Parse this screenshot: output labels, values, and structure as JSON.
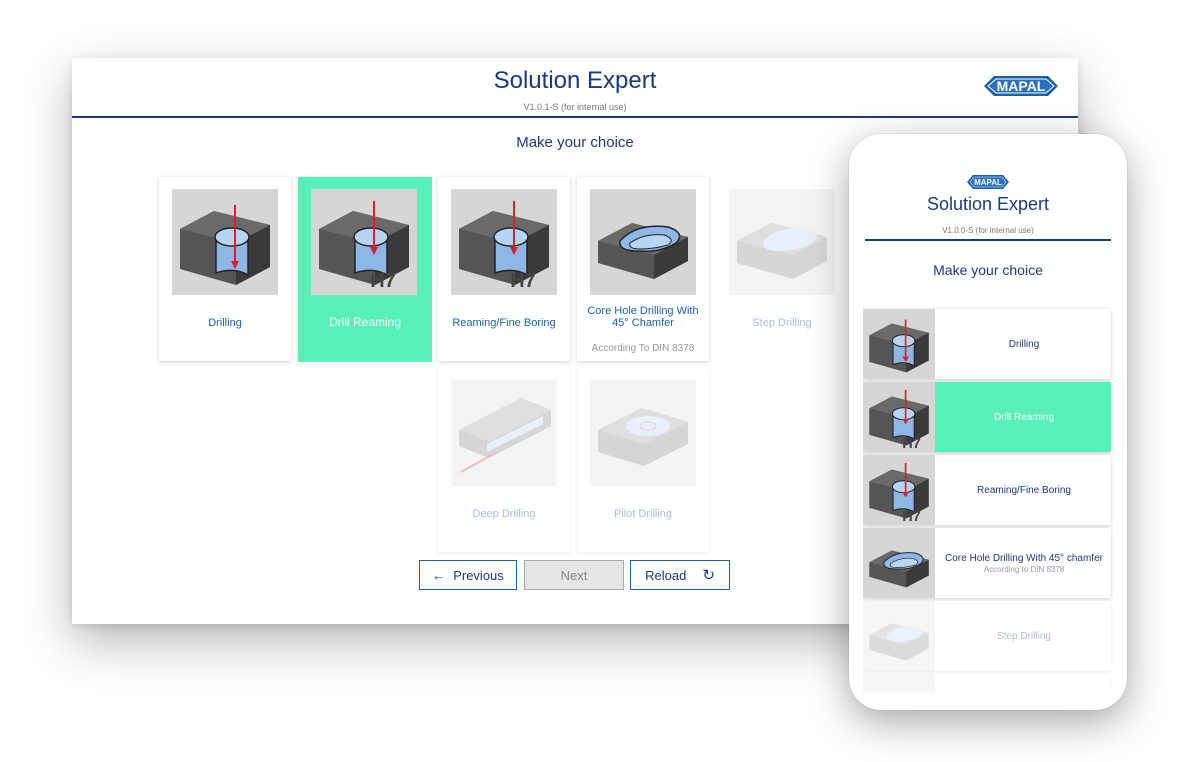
{
  "desktop": {
    "title": "Solution Expert",
    "version": "V1.0.1-S (for internal use)",
    "brand": "MAPAL",
    "choice_heading": "Make your choice",
    "cards": [
      {
        "label": "Drilling",
        "sub": "",
        "state": "normal",
        "icon": "drilling-icon"
      },
      {
        "label": "Drill Reaming",
        "sub": "",
        "state": "selected",
        "icon": "drill-reaming-icon",
        "badge": "H7"
      },
      {
        "label": "Reaming/Fine Boring",
        "sub": "",
        "state": "normal",
        "icon": "reaming-icon",
        "badge": "H7"
      },
      {
        "label": "Core Hole Drilling With 45° Chamfer",
        "sub": "According To DIN 8378",
        "state": "normal",
        "icon": "core-hole-icon"
      },
      {
        "label": "Step Drilling",
        "sub": "",
        "state": "disabled",
        "icon": "step-drilling-icon"
      },
      {
        "label": "Deep Drilling",
        "sub": "",
        "state": "disabled",
        "icon": "deep-drilling-icon"
      },
      {
        "label": "Pilot Drilling",
        "sub": "",
        "state": "disabled",
        "icon": "pilot-drilling-icon"
      }
    ],
    "buttons": {
      "previous": "Previous",
      "next": "Next",
      "reload": "Reload"
    }
  },
  "mobile": {
    "title": "Solution Expert",
    "version": "V1.0.0-S (for internal use)",
    "brand": "MAPAL",
    "choice_heading": "Make your choice",
    "items": [
      {
        "label": "Drilling",
        "sub": "",
        "state": "normal"
      },
      {
        "label": "Drill Reaming",
        "sub": "",
        "state": "selected",
        "badge": "H7"
      },
      {
        "label": "Reaming/Fine Boring",
        "sub": "",
        "state": "normal",
        "badge": "H7"
      },
      {
        "label": "Core Hole Drilling With 45° chamfer",
        "sub": "According to DIN 8378",
        "state": "normal"
      },
      {
        "label": "Step Drilling",
        "sub": "",
        "state": "disabled"
      }
    ]
  },
  "colors": {
    "brand_blue": "#1b3a7a",
    "selected": "#58efb8",
    "link_blue": "#1b5fa8"
  }
}
